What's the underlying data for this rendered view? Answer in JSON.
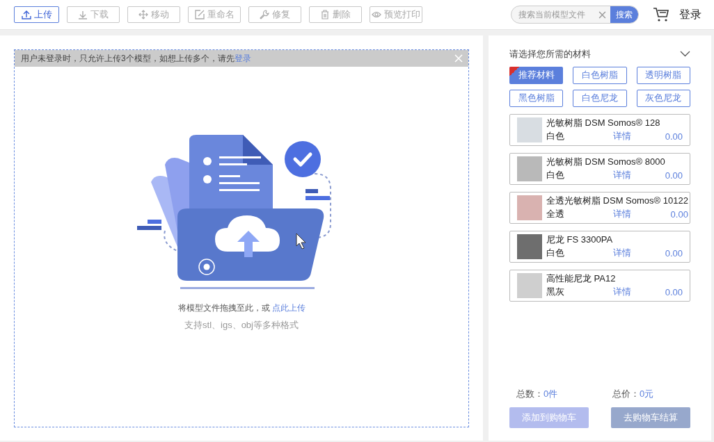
{
  "toolbar": {
    "buttons": [
      {
        "label": "上传",
        "disabled": false
      },
      {
        "label": "下载",
        "disabled": true
      },
      {
        "label": "移动",
        "disabled": true
      },
      {
        "label": "重命名",
        "disabled": true
      },
      {
        "label": "修复",
        "disabled": true
      },
      {
        "label": "删除",
        "disabled": true
      },
      {
        "label": "预览打印",
        "disabled": true
      }
    ],
    "search": {
      "placeholder": "搜索当前模型文件",
      "button": "搜索"
    },
    "login": "登录"
  },
  "upload_area": {
    "notice": {
      "text": "用户未登录时，只允许上传3个模型，如想上传多个，请先",
      "link": "登录"
    },
    "hint": "将模型文件拖拽至此，或",
    "hint_link": "点此上传",
    "formats": "支持stl、igs、obj等多种格式"
  },
  "materials": {
    "title": "请选择您所需的材料",
    "tags": [
      {
        "label": "推荐材料",
        "selected": true
      },
      {
        "label": "白色树脂",
        "selected": false
      },
      {
        "label": "透明树脂",
        "selected": false
      },
      {
        "label": "黑色树脂",
        "selected": false
      },
      {
        "label": "白色尼龙",
        "selected": false
      },
      {
        "label": "灰色尼龙",
        "selected": false
      }
    ],
    "items": [
      {
        "name": "光敏树脂 DSM Somos® 128",
        "finish": "白色",
        "details": "详情",
        "price": "0.00"
      },
      {
        "name": "光敏树脂 DSM Somos® 8000",
        "finish": "白色",
        "details": "详情",
        "price": "0.00"
      },
      {
        "name": "全透光敏树脂 DSM Somos® 10122",
        "finish": "全透",
        "details": "详情",
        "price": "0.00"
      },
      {
        "name": "尼龙 FS 3300PA",
        "finish": "白色",
        "details": "详情",
        "price": "0.00"
      },
      {
        "name": "高性能尼龙 PA12",
        "finish": "黑灰",
        "details": "详情",
        "price": "0.00"
      }
    ],
    "total_count_label": "总数：",
    "total_count": "0件",
    "total_price_label": "总价：",
    "total_price": "0元",
    "add_to_cart": "添加到购物车",
    "checkout": "去购物车结算"
  }
}
